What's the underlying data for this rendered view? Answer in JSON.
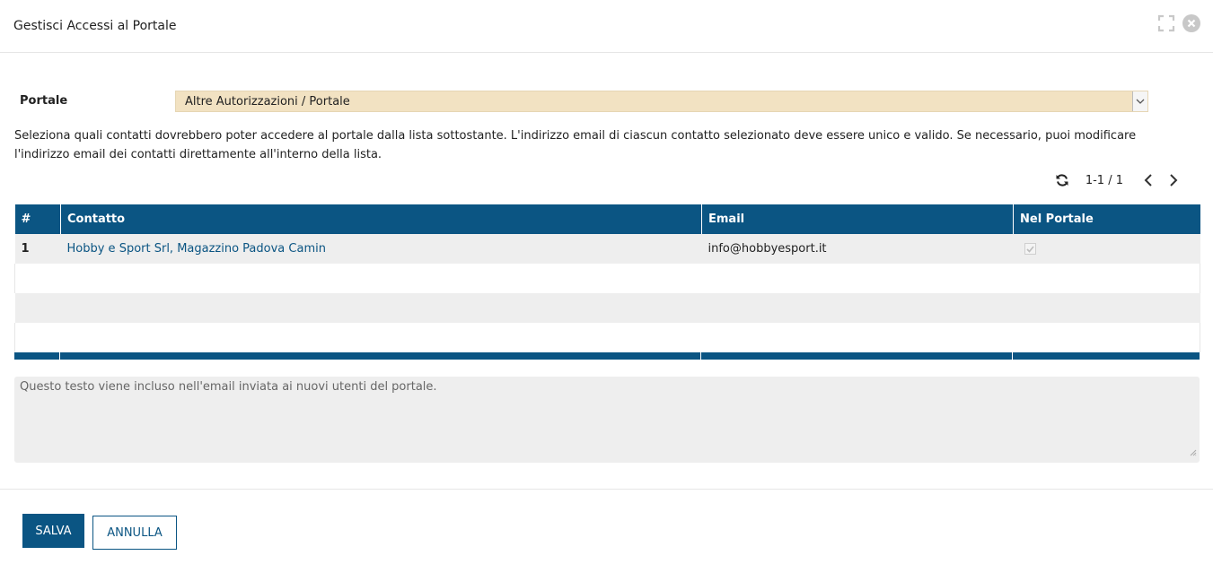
{
  "dialog": {
    "title": "Gestisci Accessi al Portale"
  },
  "portal": {
    "label": "Portale",
    "selected": "Altre Autorizzazioni / Portale"
  },
  "description": "Seleziona quali contatti dovrebbero poter accedere al portale dalla lista sottostante. L'indirizzo email di ciascun contatto selezionato deve essere unico e valido. Se necessario, puoi modificare l'indirizzo email dei contatti direttamente all'interno della lista.",
  "pager": {
    "count": "1-1 / 1"
  },
  "table": {
    "columns": [
      "#",
      "Contatto",
      "Email",
      "Nel Portale"
    ],
    "rows": [
      {
        "num": "1",
        "contact": "Hobby e Sport Srl, Magazzino Padova Camin",
        "email": "info@hobbyesport.it",
        "in_portal": true
      }
    ]
  },
  "note": {
    "placeholder": "Questo testo viene incluso nell'email inviata ai nuovi utenti del portale."
  },
  "buttons": {
    "save": "SALVA",
    "cancel": "ANNULLA"
  },
  "colors": {
    "primary": "#0b5583",
    "select_bg": "#f2e2c2",
    "row_alt": "#eeeeee"
  }
}
